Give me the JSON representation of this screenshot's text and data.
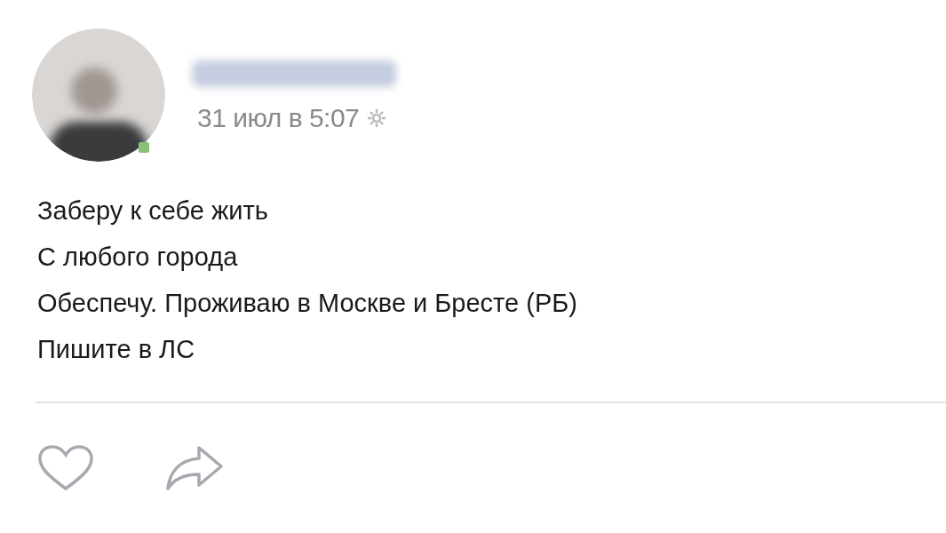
{
  "post": {
    "author": {
      "online": true
    },
    "date": "31 июл в 5:07",
    "lines": [
      "Заберу к себе жить",
      "С любого города",
      "Обеспечу. Проживаю в Москве и Бресте (РБ)",
      "Пишите в ЛС"
    ]
  }
}
